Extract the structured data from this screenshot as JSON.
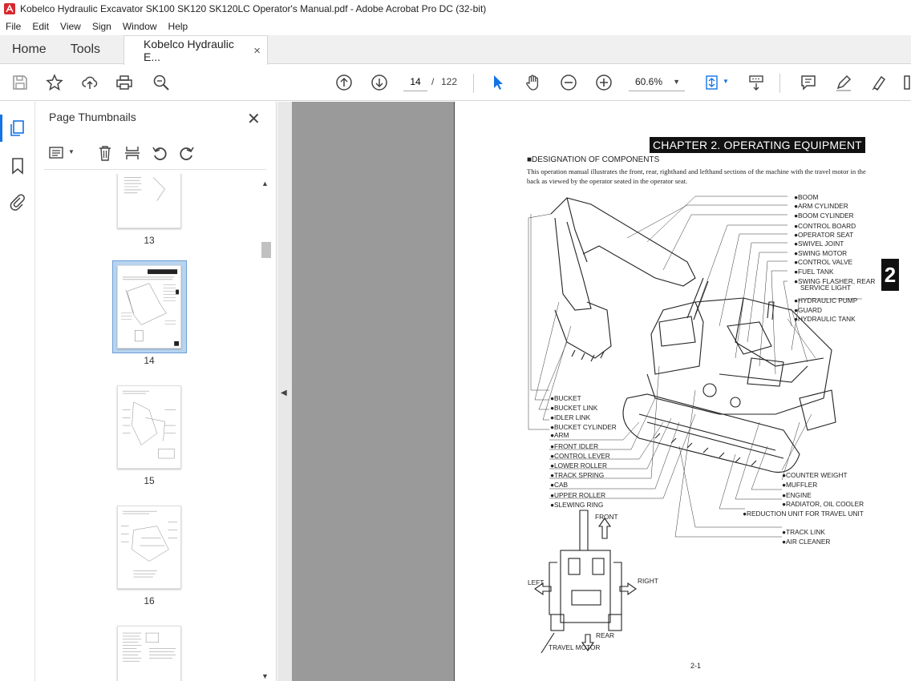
{
  "window": {
    "title": "Kobelco Hydraulic Excavator SK100 SK120 SK120LC Operator's Manual.pdf - Adobe Acrobat Pro DC (32-bit)"
  },
  "menu": {
    "items": [
      "File",
      "Edit",
      "View",
      "Sign",
      "Window",
      "Help"
    ]
  },
  "tabs": {
    "home": "Home",
    "tools": "Tools",
    "document": "Kobelco Hydraulic E...",
    "close": "×"
  },
  "toolbar": {
    "current_page": "14",
    "separator": "/",
    "total_pages": "122",
    "zoom": "60.6%"
  },
  "panel": {
    "title": "Page Thumbnails",
    "close": "✕",
    "thumbnails": [
      {
        "label": "13",
        "selected": false
      },
      {
        "label": "14",
        "selected": true
      },
      {
        "label": "15",
        "selected": false
      },
      {
        "label": "16",
        "selected": false
      },
      {
        "label": "",
        "selected": false
      }
    ]
  },
  "document_page": {
    "chapter_title": "CHAPTER 2. OPERATING EQUIPMENT",
    "chapter_tab": "2",
    "designation_heading": "■DESIGNATION OF COMPONENTS",
    "description": "This operation manual illustrates the front, rear, righthand and lefthand sections of the machine with the travel motor in the back as viewed by the operator seated in the operator seat.",
    "labels_right": [
      "●BOOM",
      "●ARM CYLINDER",
      "●BOOM CYLINDER",
      "●CONTROL BOARD",
      "●OPERATOR SEAT",
      "●SWIVEL JOINT",
      "●SWING MOTOR",
      "●CONTROL VALVE",
      "●FUEL TANK",
      "●SWING FLASHER, REAR",
      "SERVICE LIGHT",
      "●HYDRAULIC PUMP",
      "●GUARD",
      "●HYDRAULIC TANK"
    ],
    "labels_left": [
      "●BUCKET",
      "●BUCKET LINK",
      "●IDLER LINK",
      "●BUCKET CYLINDER",
      "●ARM",
      "●FRONT IDLER",
      "●CONTROL LEVER",
      "●LOWER ROLLER",
      "●TRACK SPRING",
      "●CAB",
      "●UPPER ROLLER",
      "●SLEWING RING"
    ],
    "labels_bottom_right": [
      "●COUNTER WEIGHT",
      "●MUFFLER",
      "●ENGINE",
      "●RADIATOR, OIL COOLER",
      "●REDUCTION UNIT FOR TRAVEL UNIT",
      "●TRACK LINK",
      "●AIR CLEANER"
    ],
    "direction": {
      "front": "FRONT",
      "left": "LEFT",
      "right": "RIGHT",
      "rear": "REAR",
      "travel_motor": "TRAVEL MOTOR"
    },
    "page_number": "2-1"
  },
  "colors": {
    "accent": "#1473e6",
    "viewer_bg": "#9a9a9a",
    "selection": "#b8d4ef"
  }
}
